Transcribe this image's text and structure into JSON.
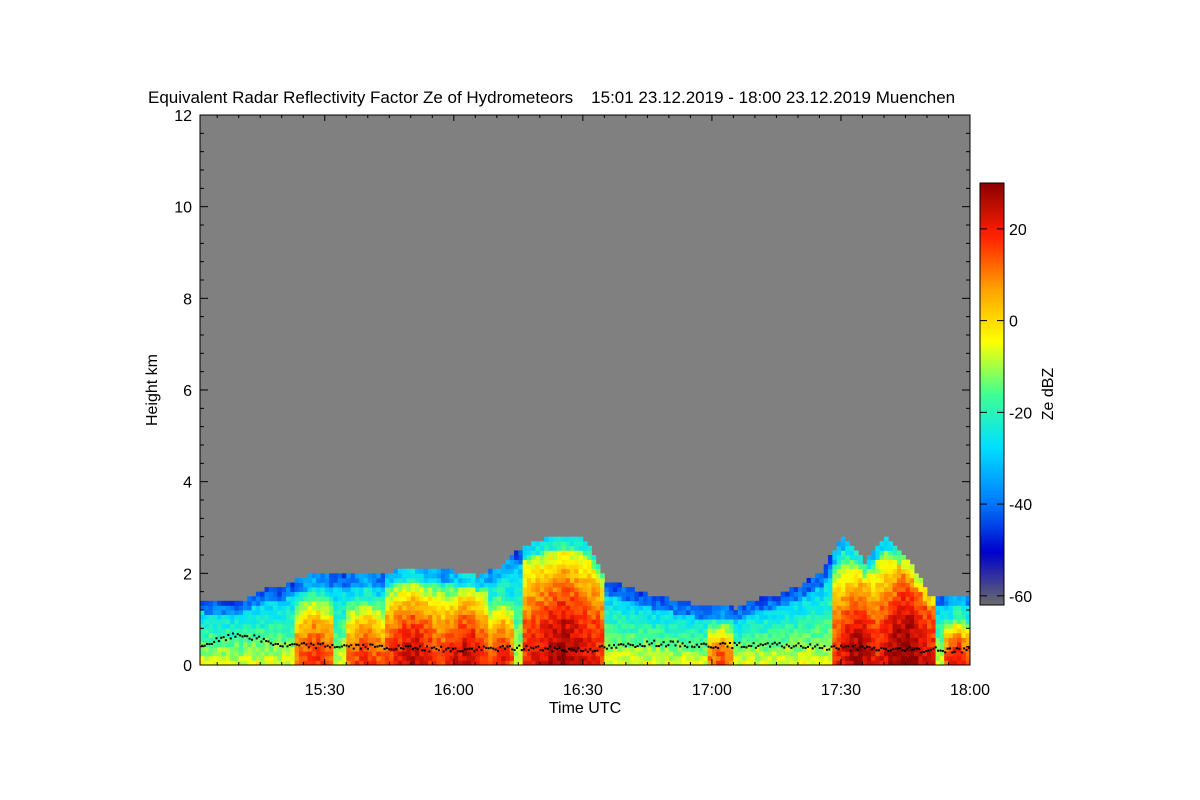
{
  "chart_data": {
    "type": "heatmap",
    "title": "Equivalent Radar Reflectivity Factor Ze of Hydrometeors",
    "period": "15:01 23.12.2019 - 18:00 23.12.2019",
    "location": "Muenchen",
    "xlabel": "Time UTC",
    "ylabel": "Height km",
    "x_range": [
      "15:01",
      "18:00"
    ],
    "x_ticks": [
      "15:30",
      "16:00",
      "16:30",
      "17:00",
      "17:30",
      "18:00"
    ],
    "y_range": [
      0,
      12
    ],
    "y_ticks": [
      0,
      2,
      4,
      6,
      8,
      10,
      12
    ],
    "background_color": "#808080",
    "colorbar": {
      "label": "Ze dBZ",
      "range": [
        -62,
        30
      ],
      "ticks": [
        20,
        0,
        -20,
        -40,
        -60
      ],
      "colormap": [
        "#6b6b6b",
        "#0000cc",
        "#0080ff",
        "#00e0ff",
        "#40ff90",
        "#ffff00",
        "#ffa000",
        "#ff2000",
        "#8b0000"
      ]
    },
    "echo_top_km": [
      {
        "time": "15:01",
        "top": 1.4
      },
      {
        "time": "15:10",
        "top": 1.35
      },
      {
        "time": "15:15",
        "top": 1.6
      },
      {
        "time": "15:20",
        "top": 1.7
      },
      {
        "time": "15:25",
        "top": 1.9
      },
      {
        "time": "15:35",
        "top": 2.0
      },
      {
        "time": "15:45",
        "top": 2.0
      },
      {
        "time": "15:50",
        "top": 2.1
      },
      {
        "time": "16:00",
        "top": 2.0
      },
      {
        "time": "16:05",
        "top": 1.9
      },
      {
        "time": "16:10",
        "top": 2.1
      },
      {
        "time": "16:15",
        "top": 2.5
      },
      {
        "time": "16:20",
        "top": 2.7
      },
      {
        "time": "16:25",
        "top": 2.75
      },
      {
        "time": "16:30",
        "top": 2.7
      },
      {
        "time": "16:35",
        "top": 1.8
      },
      {
        "time": "16:45",
        "top": 1.5
      },
      {
        "time": "16:55",
        "top": 1.3
      },
      {
        "time": "17:05",
        "top": 1.2
      },
      {
        "time": "17:10",
        "top": 1.4
      },
      {
        "time": "17:15",
        "top": 1.5
      },
      {
        "time": "17:20",
        "top": 1.7
      },
      {
        "time": "17:25",
        "top": 2.0
      },
      {
        "time": "17:30",
        "top": 2.8
      },
      {
        "time": "17:35",
        "top": 2.2
      },
      {
        "time": "17:40",
        "top": 2.8
      },
      {
        "time": "17:45",
        "top": 2.3
      },
      {
        "time": "17:50",
        "top": 1.5
      },
      {
        "time": "18:00",
        "top": 1.5
      }
    ],
    "strong_echo_cores": [
      {
        "start": "15:24",
        "end": "15:30",
        "top_km": 1.6,
        "max_dbz": 15
      },
      {
        "start": "15:36",
        "end": "15:42",
        "top_km": 1.5,
        "max_dbz": 15
      },
      {
        "start": "15:45",
        "end": "15:55",
        "top_km": 1.9,
        "max_dbz": 22
      },
      {
        "start": "15:58",
        "end": "16:07",
        "top_km": 1.8,
        "max_dbz": 22
      },
      {
        "start": "16:09",
        "end": "16:12",
        "top_km": 1.5,
        "max_dbz": 18
      },
      {
        "start": "16:17",
        "end": "16:33",
        "top_km": 2.7,
        "max_dbz": 25
      },
      {
        "start": "17:00",
        "end": "17:03",
        "top_km": 1.0,
        "max_dbz": 12
      },
      {
        "start": "17:29",
        "end": "17:38",
        "top_km": 2.3,
        "max_dbz": 25
      },
      {
        "start": "17:39",
        "end": "17:50",
        "top_km": 2.6,
        "max_dbz": 28
      },
      {
        "start": "17:55",
        "end": "17:58",
        "top_km": 1.0,
        "max_dbz": 20
      }
    ],
    "cloud_base_km": [
      {
        "time": "15:01",
        "base": 0.45
      },
      {
        "time": "15:10",
        "base": 0.7
      },
      {
        "time": "15:20",
        "base": 0.45
      },
      {
        "time": "15:30",
        "base": 0.45
      },
      {
        "time": "15:45",
        "base": 0.4
      },
      {
        "time": "16:00",
        "base": 0.35
      },
      {
        "time": "16:15",
        "base": 0.4
      },
      {
        "time": "16:30",
        "base": 0.35
      },
      {
        "time": "16:45",
        "base": 0.5
      },
      {
        "time": "17:00",
        "base": 0.45
      },
      {
        "time": "17:15",
        "base": 0.45
      },
      {
        "time": "17:30",
        "base": 0.4
      },
      {
        "time": "17:45",
        "base": 0.35
      },
      {
        "time": "18:00",
        "base": 0.35
      }
    ]
  }
}
